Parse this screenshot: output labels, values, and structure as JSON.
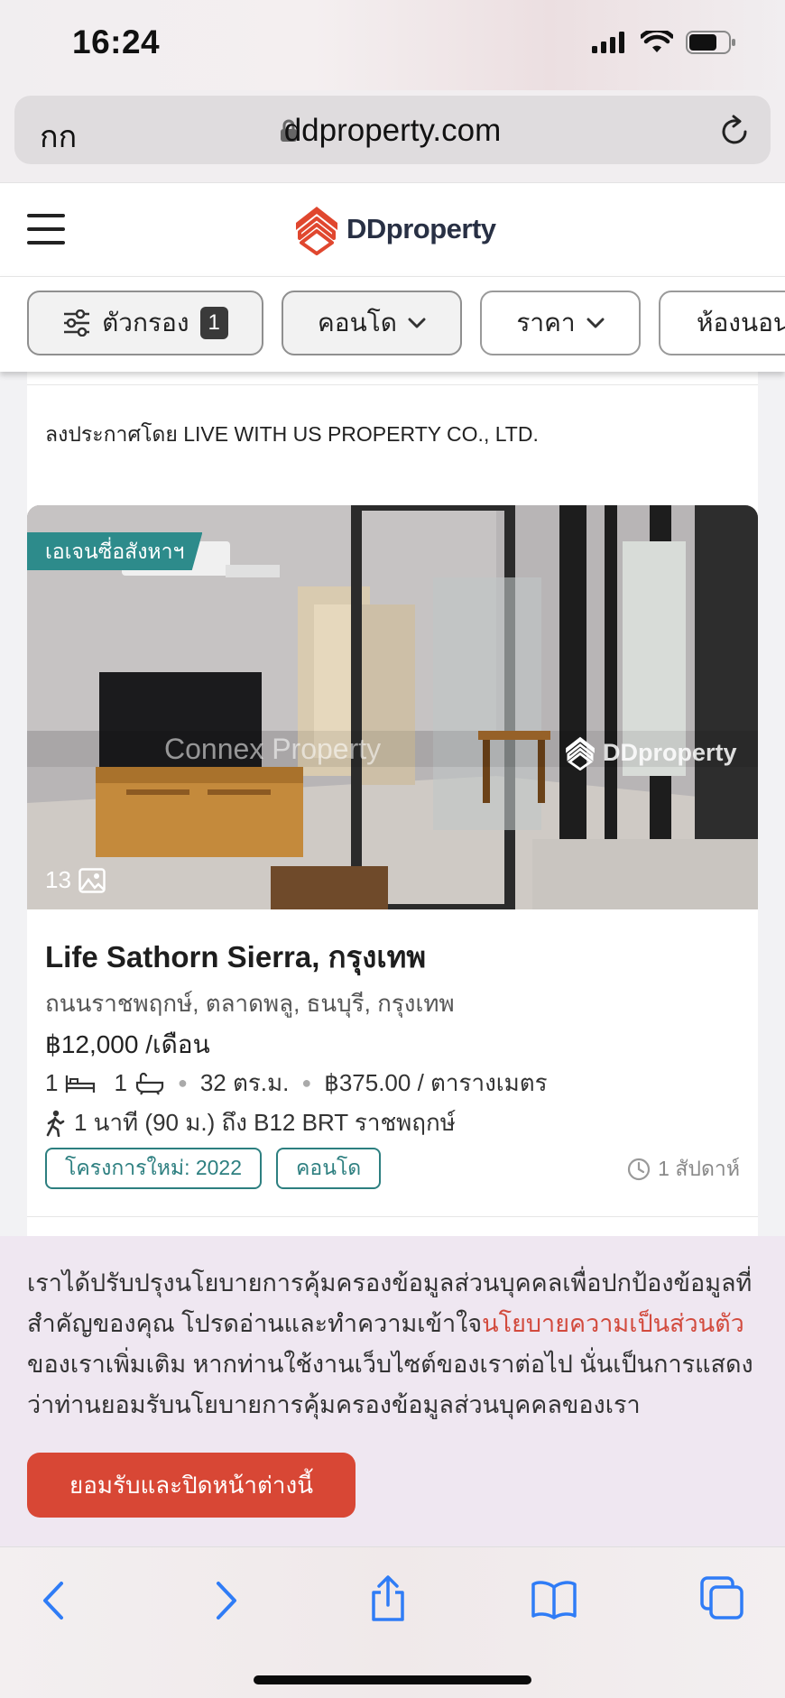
{
  "status_bar": {
    "time": "16:24"
  },
  "browser": {
    "text_size_label": "กก",
    "url": "ddproperty.com"
  },
  "header": {
    "logo_text": "DDproperty"
  },
  "filters": {
    "filter_label": "ตัวกรอง",
    "filter_count": "1",
    "condo_label": "คอนโด",
    "price_label": "ราคา",
    "bedroom_label": "ห้องนอน"
  },
  "previous_listing": {
    "posted_by": "ลงประกาศโดย LIVE WITH US PROPERTY CO., LTD."
  },
  "listing": {
    "agent_tag": "เอเจนซี่อสังหาฯ",
    "photo_count": "13",
    "watermark_agent": "Connex Property",
    "watermark_brand": "DDproperty",
    "title": "Life Sathorn Sierra, กรุงเทพ",
    "address": "ถนนราชพฤกษ์, ตลาดพลู, ธนบุรี, กรุงเทพ",
    "price": "฿12,000 /เดือน",
    "bedrooms": "1",
    "bathrooms": "1",
    "area": "32 ตร.ม.",
    "price_per_area": "฿375.00 / ตารางเมตร",
    "transit": "1 นาที (90 ม.) ถึง B12 BRT ราชพฤกษ์",
    "tags": [
      "โครงการใหม่: 2022",
      "คอนโด"
    ],
    "posted_ago": "1 สัปดาห์"
  },
  "cookie": {
    "text_before": "เราได้ปรับปรุงนโยบายการคุ้มครองข้อมูลส่วนบุคคลเพื่อปกป้องข้อมูลที่สำคัญของคุณ โปรดอ่านและทำความเข้าใจ",
    "link_text": "นโยบายความเป็นส่วนตัว",
    "text_after": "ของเราเพิ่มเติม หากท่านใช้งานเว็บไซต์ของเราต่อไป นั่นเป็นการแสดงว่าท่านยอมรับนโยบายการคุ้มครองข้อมูลส่วนบุคคลของเรา",
    "accept_label": "ยอมรับและปิดหน้าต่างนี้"
  },
  "colors": {
    "brand_red": "#d84735",
    "teal": "#2d8b8b",
    "ios_blue": "#2f7cf6"
  }
}
